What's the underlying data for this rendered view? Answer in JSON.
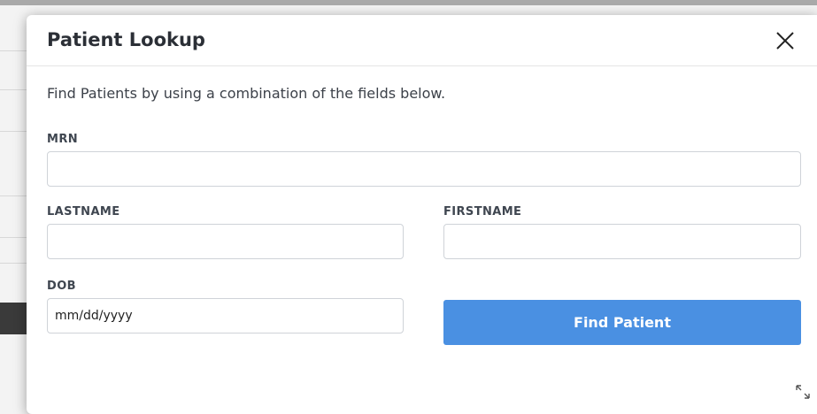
{
  "modal": {
    "title": "Patient Lookup",
    "intro": "Find Patients by using a combination of the fields below.",
    "close_icon": "close-icon",
    "resize_icon": "expand-arrows-icon"
  },
  "fields": {
    "mrn": {
      "label": "MRN",
      "value": "",
      "placeholder": ""
    },
    "lastname": {
      "label": "LASTNAME",
      "value": "",
      "placeholder": ""
    },
    "firstname": {
      "label": "FIRSTNAME",
      "value": "",
      "placeholder": ""
    },
    "dob": {
      "label": "DOB",
      "value": "",
      "placeholder": "mm/dd/yyyy"
    }
  },
  "actions": {
    "find_label": "Find Patient"
  },
  "colors": {
    "primary": "#4a90e2",
    "title": "#2b2f36",
    "label": "#3f4650"
  }
}
